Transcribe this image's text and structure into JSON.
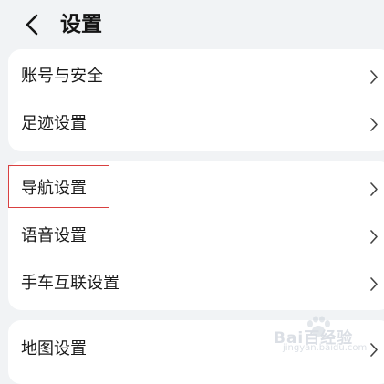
{
  "header": {
    "title": "设置",
    "back_icon": "chevron-left-icon"
  },
  "groups": [
    {
      "items": [
        {
          "label": "账号与安全"
        },
        {
          "label": "足迹设置"
        }
      ]
    },
    {
      "items": [
        {
          "label": "导航设置"
        },
        {
          "label": "语音设置"
        },
        {
          "label": "手车互联设置"
        }
      ]
    },
    {
      "items": [
        {
          "label": "地图设置"
        }
      ]
    }
  ],
  "row_chevron_icon": "chevron-right-icon",
  "highlight_color": "#d94040",
  "watermark": {
    "text": "Bai百经验",
    "url": "jingyan.baidu.com"
  }
}
